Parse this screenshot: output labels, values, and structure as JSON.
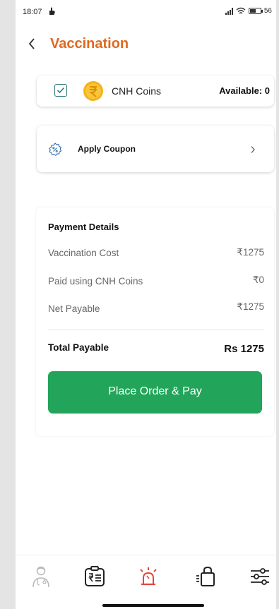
{
  "status_bar": {
    "time": "18:07",
    "battery_text": "56",
    "battery_level": 0.56
  },
  "header": {
    "title": "Vaccination",
    "back_icon": "chevron-left-icon"
  },
  "coins": {
    "checked": true,
    "label": "CNH Coins",
    "available_text": "Available: 0",
    "icon": "rupee-coin-icon"
  },
  "coupon": {
    "label": "Apply Coupon",
    "icon": "discount-badge-icon"
  },
  "payment": {
    "title": "Payment Details",
    "rows": [
      {
        "label": "Vaccination Cost",
        "value": "₹1275"
      },
      {
        "label": "Paid using CNH Coins",
        "value": "₹0"
      },
      {
        "label": "Net Payable",
        "value": "₹1275"
      }
    ],
    "total_label": "Total Payable",
    "total_value": "Rs 1275",
    "button_label": "Place Order & Pay"
  },
  "bottom_nav": [
    {
      "icon": "doctor-icon"
    },
    {
      "icon": "id-card-icon"
    },
    {
      "icon": "alarm-siren-icon",
      "active": true
    },
    {
      "icon": "shopping-bag-icon"
    },
    {
      "icon": "settings-sliders-icon"
    }
  ],
  "colors": {
    "accent": "#e0691f",
    "primary_button": "#22a55a",
    "checkbox": "#2f7a78",
    "siren": "#e0483a"
  }
}
